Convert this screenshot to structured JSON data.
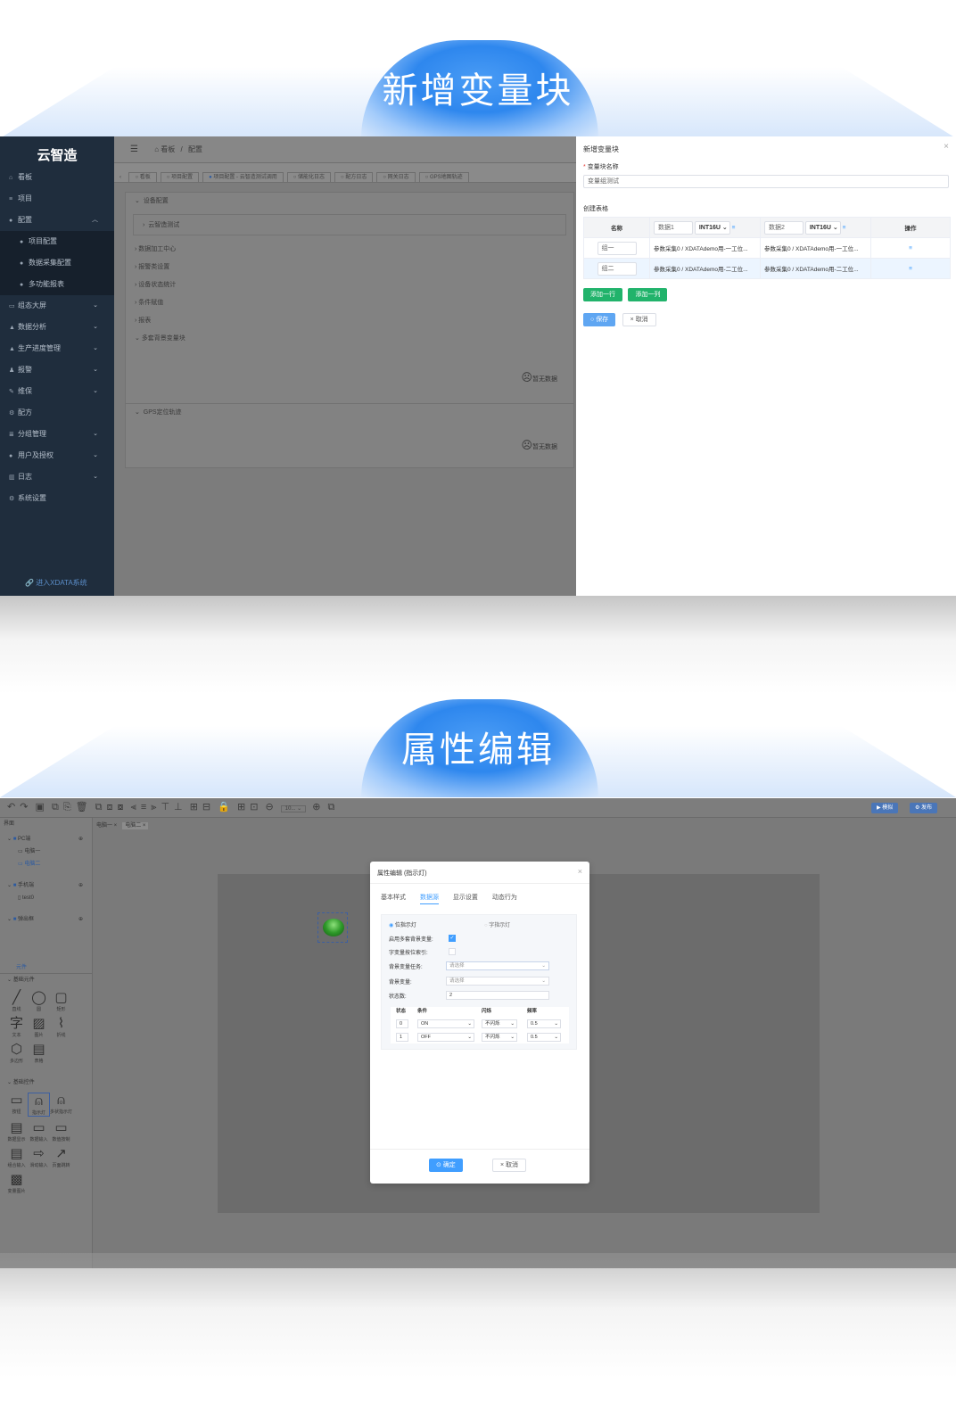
{
  "banner1": {
    "title": "新增变量块"
  },
  "banner2": {
    "title": "属性编辑"
  },
  "shot1": {
    "sidebar": {
      "logo": "云智造",
      "items": [
        {
          "label": "看板",
          "icon": "home-icon",
          "chevron": false,
          "sub": false
        },
        {
          "label": "项目",
          "icon": "list-icon",
          "chevron": false,
          "sub": false
        },
        {
          "label": "配置",
          "icon": "dot-icon",
          "chevron": true,
          "sub": false
        },
        {
          "label": "项目配置",
          "icon": "dot-icon",
          "chevron": false,
          "sub": true
        },
        {
          "label": "数据采集配置",
          "icon": "dot-icon",
          "chevron": false,
          "sub": true
        },
        {
          "label": "多功能报表",
          "icon": "dot-icon",
          "chevron": false,
          "sub": true
        },
        {
          "label": "组态大屏",
          "icon": "screen-icon",
          "chevron": true,
          "sub": false
        },
        {
          "label": "数据分析",
          "icon": "chart-icon",
          "chevron": true,
          "sub": false
        },
        {
          "label": "生产进度管理",
          "icon": "chart-icon",
          "chevron": true,
          "sub": false
        },
        {
          "label": "报警",
          "icon": "bell-icon",
          "chevron": true,
          "sub": false
        },
        {
          "label": "维保",
          "icon": "wrench-icon",
          "chevron": true,
          "sub": false
        },
        {
          "label": "配方",
          "icon": "gear-icon",
          "chevron": false,
          "sub": false
        },
        {
          "label": "分组管理",
          "icon": "group-icon",
          "chevron": true,
          "sub": false
        },
        {
          "label": "用户及授权",
          "icon": "user-icon",
          "chevron": true,
          "sub": false
        },
        {
          "label": "日志",
          "icon": "log-icon",
          "chevron": true,
          "sub": false
        },
        {
          "label": "系统设置",
          "icon": "gear-icon",
          "chevron": false,
          "sub": false
        }
      ],
      "bottom_link": "进入XDATA系统"
    },
    "breadcrumb": {
      "home": "看板",
      "sep": "/",
      "current": "配置"
    },
    "tabs": [
      "看板",
      "项目配置",
      "项目配置 - 云智造测试调用",
      "储能化日志",
      "配方日志",
      "网关日志",
      "GPS地图轨迹"
    ],
    "tree": {
      "section1": "设备配置",
      "child1": "云智造测试",
      "rows": [
        "数据加工中心",
        "报警类设置",
        "设备状态统计",
        "条件赋值",
        "报表",
        "多套背景变量块"
      ],
      "section2": "GPS定位轨迹",
      "nodata": "暂无数据"
    },
    "drawer": {
      "title": "新增变量块",
      "close": "×",
      "name_label": "变量块名称",
      "required_mark": "*",
      "name_value": "变量组测试",
      "table_label": "创建表格",
      "col_name": "名称",
      "col1_name": "数据1",
      "col1_type": "INT16U",
      "col2_name": "数据2",
      "col2_type": "INT16U",
      "col_op": "操作",
      "rows": [
        {
          "name": "组一",
          "c1": "参数采集0 / XDATAdemo用-一工位...",
          "c2": "参数采集0 / XDATAdemo用-一工位..."
        },
        {
          "name": "组二",
          "c1": "参数采集0 / XDATAdemo用-二工位...",
          "c2": "参数采集0 / XDATAdemo用-二工位..."
        }
      ],
      "add_row": "添加一行",
      "add_col": "添加一列",
      "save": "保存",
      "cancel": "取消"
    }
  },
  "shot2": {
    "toolbar": {
      "zoom": "10...",
      "simulate": "模拟",
      "publish": "发布"
    },
    "screen_tabs": [
      "电脑一",
      "电脑二"
    ],
    "left": {
      "root": "界面",
      "pc_group": "PC端",
      "pc_items": [
        "电脑一",
        "电脑二"
      ],
      "mobile_group": "手机端",
      "mobile_items": [
        "test0"
      ],
      "popup_group": "弹出框",
      "elements_tab": "元件",
      "basic_elements": "基础元件",
      "basic_items": [
        "直线",
        "圆",
        "矩形",
        "文本",
        "图片",
        "折线",
        "多边形",
        "表格"
      ],
      "basic_controls": "基础控件",
      "control_items": [
        "按钮",
        "指示灯",
        "多状指示灯",
        "数据显示",
        "数据输入",
        "数值按制",
        "组合输入",
        "滑动输入",
        "页面跳转",
        "变量图片"
      ]
    },
    "dialog": {
      "title": "属性编辑 (指示灯)",
      "tabs": [
        "基本样式",
        "数据源",
        "显示设置",
        "动态行为"
      ],
      "radio_bit": "位指示灯",
      "radio_word": "字指示灯",
      "enable_multi_bg": "启用多套背景变量:",
      "word_index": "字变量按位索引:",
      "bg_task": "背景变量任务:",
      "bg_var": "背景变量:",
      "placeholder": "请选择",
      "state_count_label": "状态数:",
      "state_count": "2",
      "table_headers": [
        "状态",
        "条件",
        "闪烁",
        "频率"
      ],
      "table_rows": [
        {
          "state": "0",
          "cond": "ON",
          "blink": "不闪烁",
          "freq": "0.5"
        },
        {
          "state": "1",
          "cond": "OFF",
          "blink": "不闪烁",
          "freq": "0.5"
        }
      ],
      "ok": "确定",
      "cancel": "取消"
    }
  }
}
